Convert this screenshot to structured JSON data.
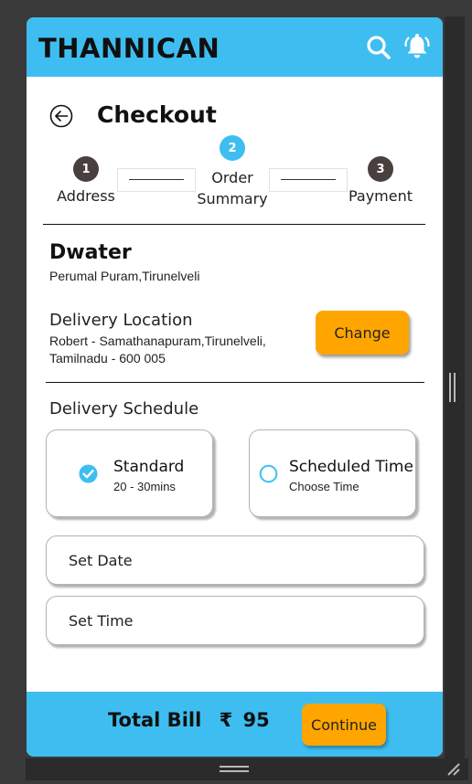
{
  "header": {
    "brand": "THANNICAN",
    "search_icon": "search-icon",
    "bell_icon": "bell-ringing-icon",
    "color": "#3ebef0"
  },
  "page": {
    "back_icon": "arrow-left-circle-icon",
    "title": "Checkout"
  },
  "stepper": {
    "steps": [
      {
        "number": "1",
        "label": "Address",
        "state": "inactive"
      },
      {
        "number": "2",
        "label": "Order Summary",
        "label_lines": [
          "Order",
          "Summary"
        ],
        "state": "active"
      },
      {
        "number": "3",
        "label": "Payment",
        "state": "inactive"
      }
    ],
    "active_color": "#3ebef0",
    "inactive_color": "#4a3f3f"
  },
  "vendor": {
    "name": "Dwater",
    "address": "Perumal Puram,Tirunelveli"
  },
  "delivery": {
    "label": "Delivery Location",
    "address_line1": "Robert - Samathanapuram,Tirunelveli,",
    "address_line2": "Tamilnadu - 600 005",
    "change_label": "Change"
  },
  "schedule": {
    "label": "Delivery Schedule",
    "options": [
      {
        "title": "Standard",
        "subtitle": "20 - 30mins",
        "selected": true
      },
      {
        "title": "Scheduled Time",
        "subtitle": "Choose Time",
        "selected": false
      }
    ],
    "set_date_label": "Set Date",
    "set_time_label": "Set Time"
  },
  "footer": {
    "total_label": "Total Bill",
    "currency": "₹",
    "amount": "95",
    "continue_label": "Continue"
  },
  "colors": {
    "accent": "#3ebef0",
    "button": "#ffa500"
  }
}
